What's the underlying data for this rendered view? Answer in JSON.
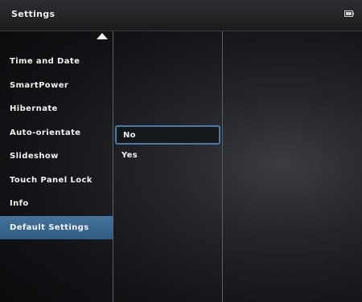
{
  "header": {
    "title": "Settings",
    "battery_icon": "battery-icon"
  },
  "menu": {
    "scroll_icon": "triangle-up-icon",
    "items": [
      {
        "label": "Time and Date",
        "selected": false
      },
      {
        "label": "SmartPower",
        "selected": false
      },
      {
        "label": "Hibernate",
        "selected": false
      },
      {
        "label": "Auto-orientate",
        "selected": false
      },
      {
        "label": "Slideshow",
        "selected": false
      },
      {
        "label": "Touch Panel Lock",
        "selected": false
      },
      {
        "label": "Info",
        "selected": false
      },
      {
        "label": "Default Settings",
        "selected": true
      }
    ]
  },
  "submenu": {
    "options": [
      {
        "label": "No",
        "focused": true
      },
      {
        "label": "Yes",
        "focused": false
      }
    ]
  },
  "colors": {
    "selection": "#3d6a92",
    "focus_border": "#4b7aa8",
    "text": "#f2f2f2"
  }
}
